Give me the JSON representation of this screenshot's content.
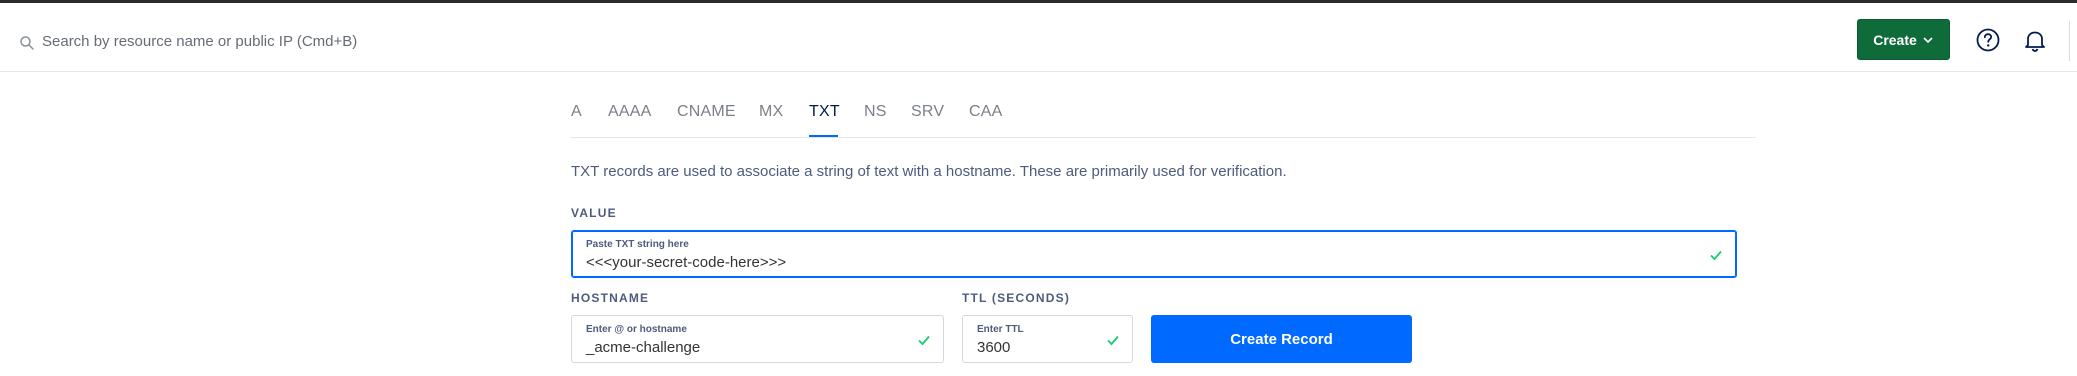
{
  "header": {
    "search_placeholder": "Search by resource name or public IP (Cmd+B)",
    "create_label": "Create"
  },
  "tabs": [
    {
      "label": "A"
    },
    {
      "label": "AAAA"
    },
    {
      "label": "CNAME"
    },
    {
      "label": "MX"
    },
    {
      "label": "TXT",
      "active": true
    },
    {
      "label": "NS"
    },
    {
      "label": "SRV"
    },
    {
      "label": "CAA"
    }
  ],
  "description": "TXT records are used to associate a string of text with a hostname. These are primarily used for verification.",
  "value_section": {
    "heading": "VALUE",
    "field_label": "Paste TXT string here",
    "field_value": "<<<your-secret-code-here>>>"
  },
  "hostname_section": {
    "heading": "HOSTNAME",
    "field_label": "Enter @ or hostname",
    "field_value": "_acme-challenge"
  },
  "ttl_section": {
    "heading": "TTL (SECONDS)",
    "field_label": "Enter TTL",
    "field_value": "3600"
  },
  "submit_label": "Create Record",
  "colors": {
    "create_button": "#0f6b3a",
    "primary": "#0069ff",
    "check": "#15cd72",
    "active_tab": "#031b4e"
  },
  "icons": [
    "search-icon",
    "chevron-down-icon",
    "help-icon",
    "bell-icon",
    "check-icon"
  ]
}
